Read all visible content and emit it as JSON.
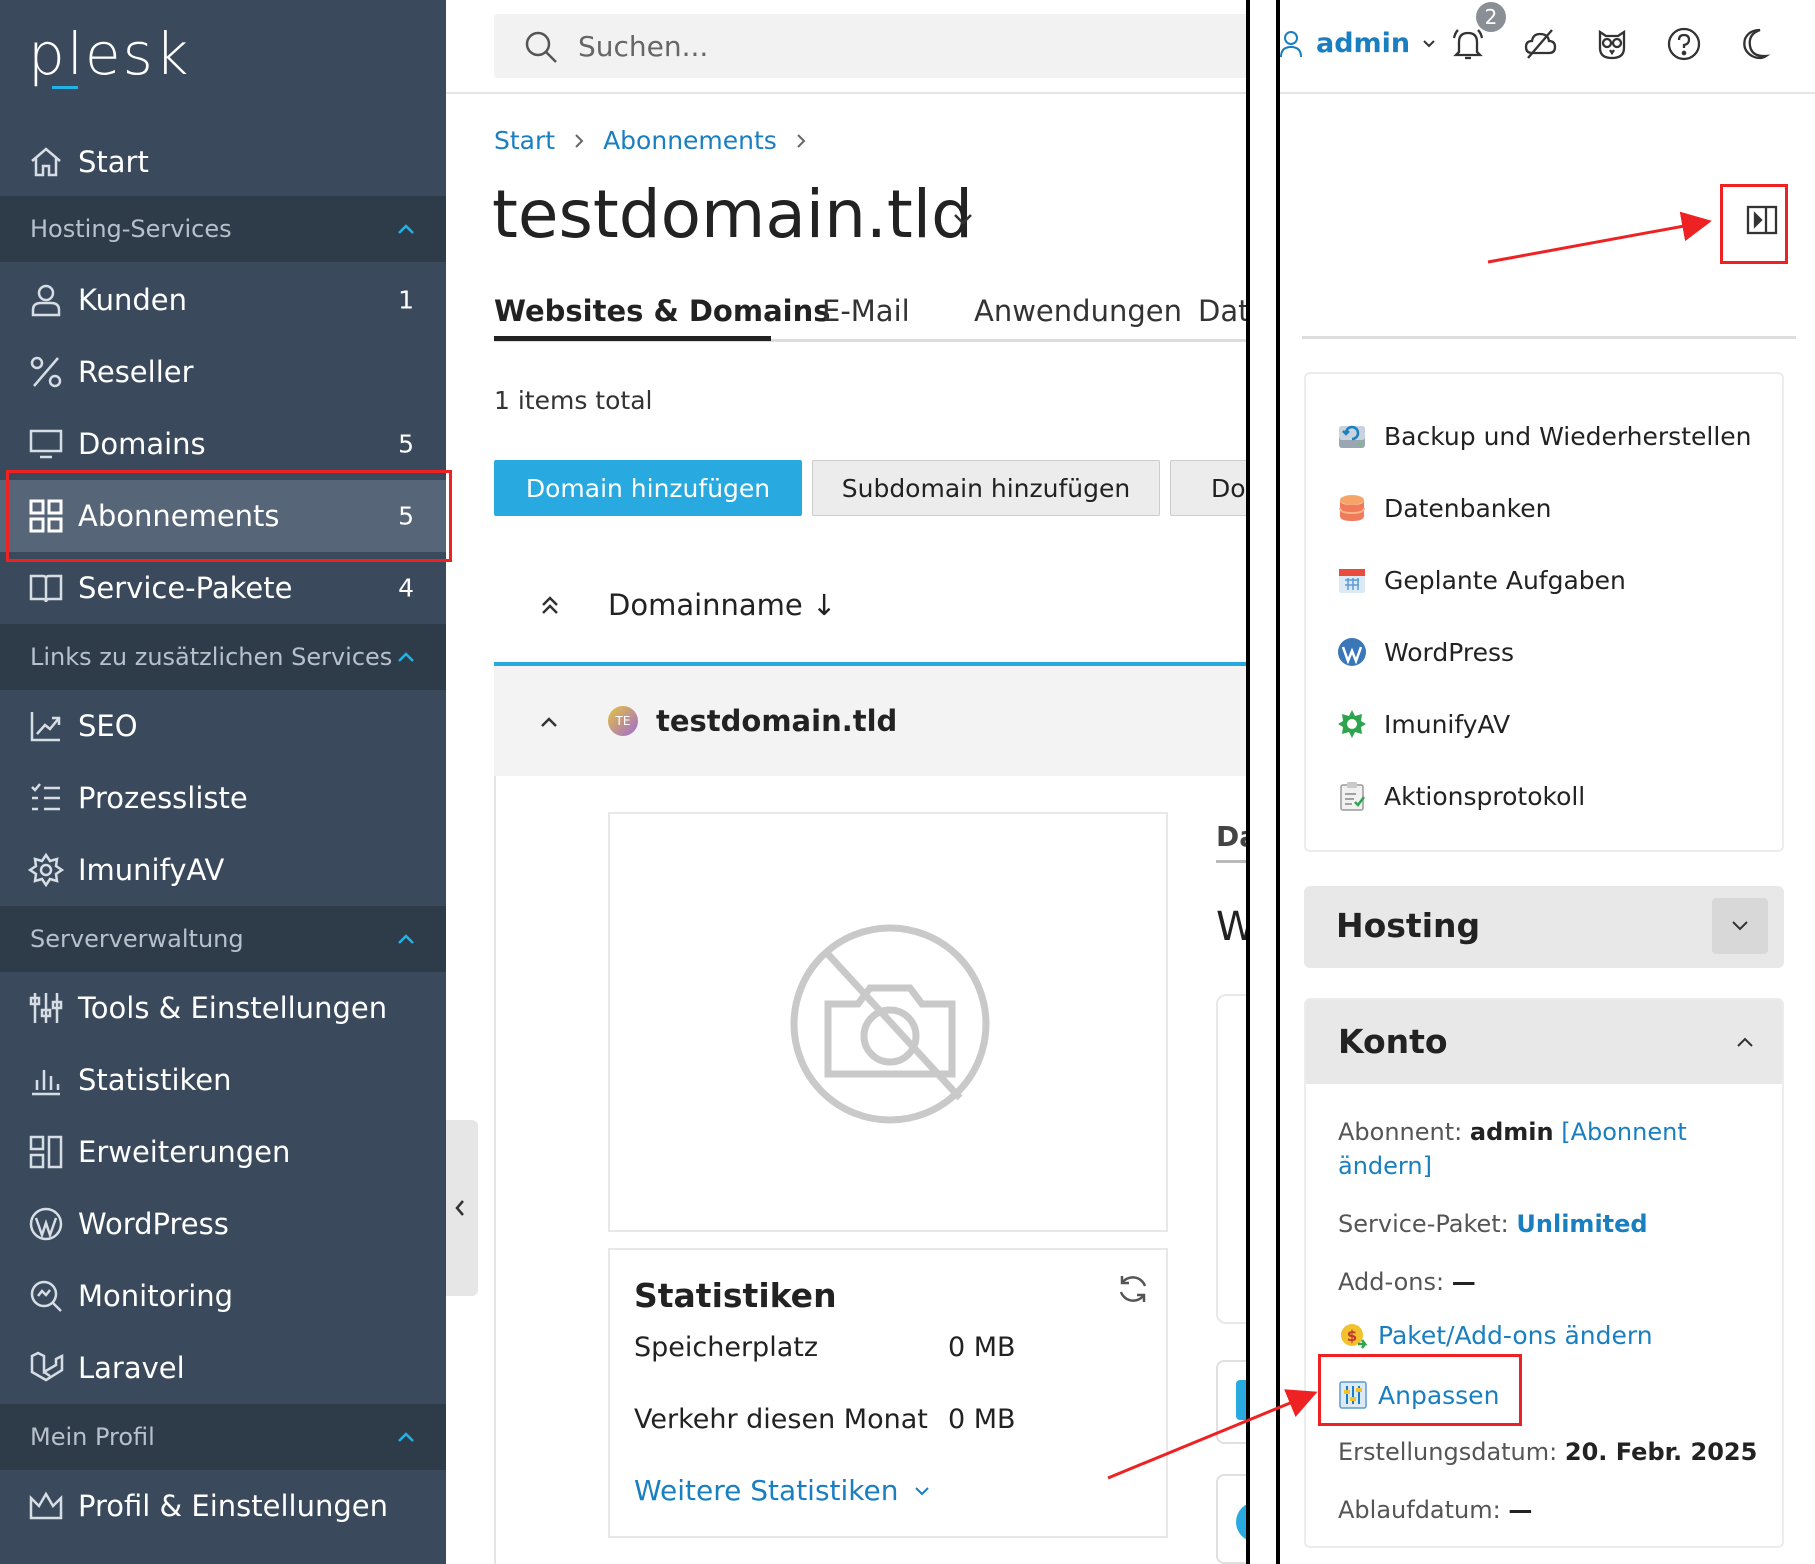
{
  "sidebar": {
    "logo": "plesk",
    "start": "Start",
    "groups": {
      "hosting": "Hosting-Services",
      "links": "Links zu zusätzlichen Services",
      "server": "Serververwaltung",
      "profile": "Mein Profil"
    },
    "items": {
      "kunden": {
        "label": "Kunden",
        "count": "1"
      },
      "reseller": {
        "label": "Reseller"
      },
      "domains": {
        "label": "Domains",
        "count": "5"
      },
      "abonnements": {
        "label": "Abonnements",
        "count": "5"
      },
      "service_pakete": {
        "label": "Service-Pakete",
        "count": "4"
      },
      "seo": {
        "label": "SEO"
      },
      "prozessliste": {
        "label": "Prozessliste"
      },
      "imunifyav": {
        "label": "ImunifyAV"
      },
      "tools": {
        "label": "Tools & Einstellungen"
      },
      "statistiken": {
        "label": "Statistiken"
      },
      "erweiterungen": {
        "label": "Erweiterungen"
      },
      "wordpress": {
        "label": "WordPress"
      },
      "monitoring": {
        "label": "Monitoring"
      },
      "laravel": {
        "label": "Laravel"
      },
      "profil": {
        "label": "Profil & Einstellungen"
      }
    }
  },
  "search": {
    "placeholder": "Suchen..."
  },
  "breadcrumb": {
    "start": "Start",
    "abonnements": "Abonnements"
  },
  "page": {
    "title": "testdomain.tld",
    "tabs": [
      "Websites & Domains",
      "E-Mail",
      "Anwendungen",
      "Date"
    ],
    "items_total": "1 items total",
    "buttons": {
      "add_domain": "Domain hinzufügen",
      "add_subdomain": "Subdomain hinzufügen",
      "partial": "Dor"
    },
    "column_header": "Domainname ↓",
    "domain_row": {
      "avatar": "TE",
      "name": "testdomain.tld"
    },
    "stats": {
      "title": "Statistiken",
      "storage_label": "Speicherplatz",
      "storage_value": "0 MB",
      "traffic_label": "Verkehr diesen Monat",
      "traffic_value": "0 MB",
      "more": "Weitere Statistiken"
    },
    "partial_heading": "Da",
    "partial_w": "W"
  },
  "topbar": {
    "user": "admin",
    "notifications": "2"
  },
  "tools": {
    "backup": "Backup und Wiederherstellen",
    "datenbanken": "Datenbanken",
    "geplante": "Geplante Aufgaben",
    "wordpress": "WordPress",
    "imunifyav": "ImunifyAV",
    "aktionsprotokoll": "Aktionsprotokoll"
  },
  "hosting": {
    "title": "Hosting"
  },
  "konto": {
    "title": "Konto",
    "abonnent_label": "Abonnent:",
    "abonnent_value": "admin",
    "abonnent_link_1": "[Abonnent",
    "abonnent_link_2": "ändern]",
    "paket_label": "Service-Paket:",
    "paket_value": "Unlimited",
    "addons_label": "Add-ons:",
    "addons_value": "—",
    "change_link": "Paket/Add-ons ändern",
    "anpassen_link": "Anpassen",
    "erstellung_label": "Erstellungsdatum:",
    "erstellung_value": "20. Febr. 2025",
    "ablauf_label": "Ablaufdatum:",
    "ablauf_value": "—"
  },
  "colors": {
    "sidebar": "#3a4a5c",
    "sidebar_group": "#2e3b49",
    "accent": "#28a9e0",
    "link": "#1a7fc0",
    "highlight": "#ee2222"
  }
}
